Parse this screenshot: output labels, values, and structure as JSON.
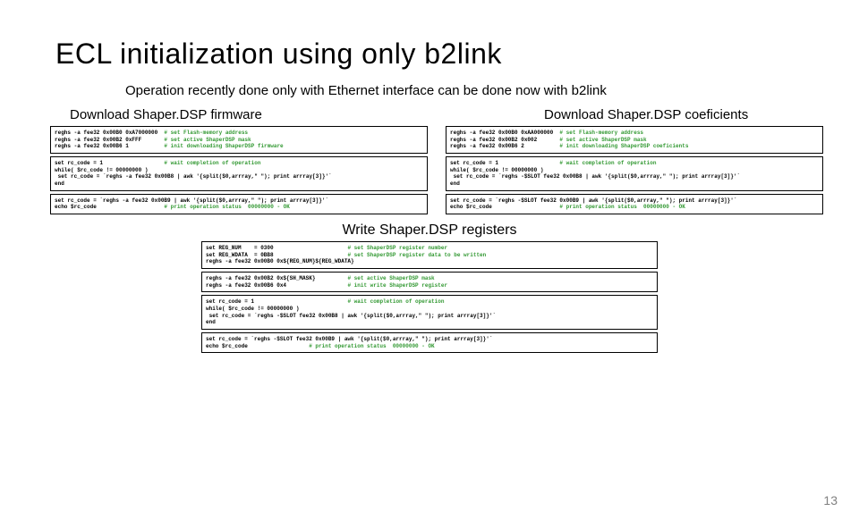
{
  "title": "ECL initialization using only b2link",
  "subtitle": "Operation recently done only with Ethernet interface can be done now with b2link",
  "left": {
    "label": "Download Shaper.DSP firmware",
    "box1_cmd": "reghs -a fee32 0x00B0 0xA7000000\nreghs -a fee32 0x00B2 0xFFF\nreghs -a fee32 0x00B6 1",
    "box1_cmt": "# set Flash-memory address\n# set active ShaperDSP mask\n# init downloading ShaperDSP firmware",
    "box2": "set rc_code = 1\nwhile( $rc_code != 00000000 )\n set rc_code = `reghs -a fee32 0x00B8 | awk '{split($0,arrray,\" \"); print arrray[3]}'`\nend",
    "box2_cmt_line": "# wait completion of operation",
    "box3": "set rc_code = `reghs -a fee32 0x00B9 | awk '{split($0,arrray,\" \"); print arrray[3]}'`\necho $rc_code",
    "box3_cmt": "# print operation status  00000000 - OK"
  },
  "right": {
    "label": "Download Shaper.DSP coeficients",
    "box1_cmd": "reghs -a fee32 0x00B0 0xAA000000\nreghs -a fee32 0x00B2 0x002\nreghs -a fee32 0x00B6 2",
    "box1_cmt": "# set Flash-memory address\n# set active ShaperDSP mask\n# init downloading ShaperDSP coeficients",
    "box2": "set rc_code = 1\nwhile( $rc_code != 00000000 )\n set rc_code = `reghs -$SLOT fee32 0x00B8 | awk '{split($0,arrray,\" \"); print arrray[3]}'`\nend",
    "box2_cmt_line": "# wait completion of operation",
    "box3": "set rc_code = `reghs -$SLOT fee32 0x00B9 | awk '{split($0,arrray,\" \"); print arrray[3]}'`\necho $rc_code",
    "box3_cmt": "# print operation status  00000000 - OK"
  },
  "bottom": {
    "label": "Write Shaper.DSP registers",
    "box1_cmd": "set REG_NUM    = 0300\nset REG_WDATA  = 0BB8\nreghs -a fee32 0x00B0 0x${REG_NUM}${REG_WDATA}",
    "box1_cmt": "# set ShaperDSP register number\n# set ShaperDSP register data to be written",
    "box2_cmd": "reghs -a fee32 0x00B2 0x${SH_MASK}\nreghs -a fee32 0x00B6 0x4",
    "box2_cmt": "# set active ShaperDSP mask\n# init write ShaperDSP register",
    "box3": "set rc_code = 1\nwhile( $rc_code != 00000000 )\n set rc_code = `reghs -$SLOT fee32 0x00B8 | awk '{split($0,arrray,\" \"); print arrray[3]}'`\nend",
    "box3_cmt_line": "# wait completion of operation",
    "box4": "set rc_code = `reghs -$SLOT fee32 0x00B9 | awk '{split($0,arrray,\" \"); print arrray[3]}'`\necho $rc_code",
    "box4_cmt": "# print operation status  00000000 - OK"
  },
  "page": "13"
}
